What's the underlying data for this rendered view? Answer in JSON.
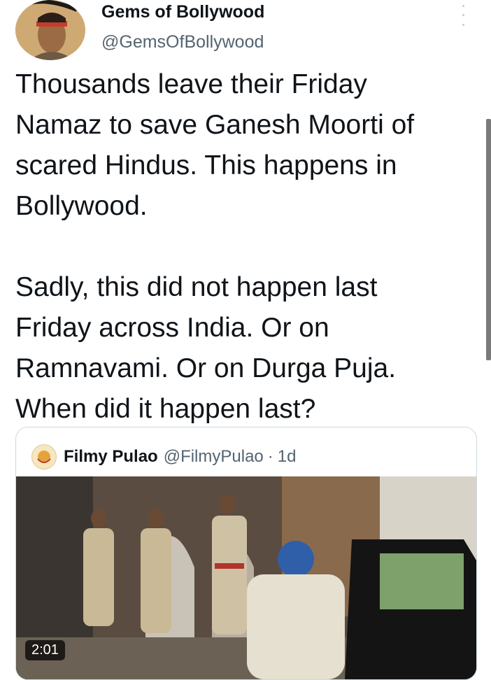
{
  "tweet": {
    "author_name": "Gems of Bollywood",
    "author_handle": "@GemsOfBollywood",
    "text": "Thousands leave their Friday\nNamaz to save Ganesh Moorti of\nscared Hindus. This happens in\nBollywood.\n\nSadly, this did not happen last\nFriday across India. Or on\nRamnavami. Or on Durga Puja.\nWhen did it happen last?"
  },
  "icons": {
    "more": "more-options-icon",
    "avatar": "avatar",
    "quoted_avatar": "avatar"
  },
  "quoted_tweet": {
    "author_name": "Filmy Pulao",
    "author_handle": "@FilmyPulao",
    "separator": "·",
    "time": "1d",
    "video": {
      "duration": "2:01"
    }
  },
  "colors": {
    "text": "#0f1419",
    "secondary": "#536471",
    "border": "#cfd9de"
  }
}
